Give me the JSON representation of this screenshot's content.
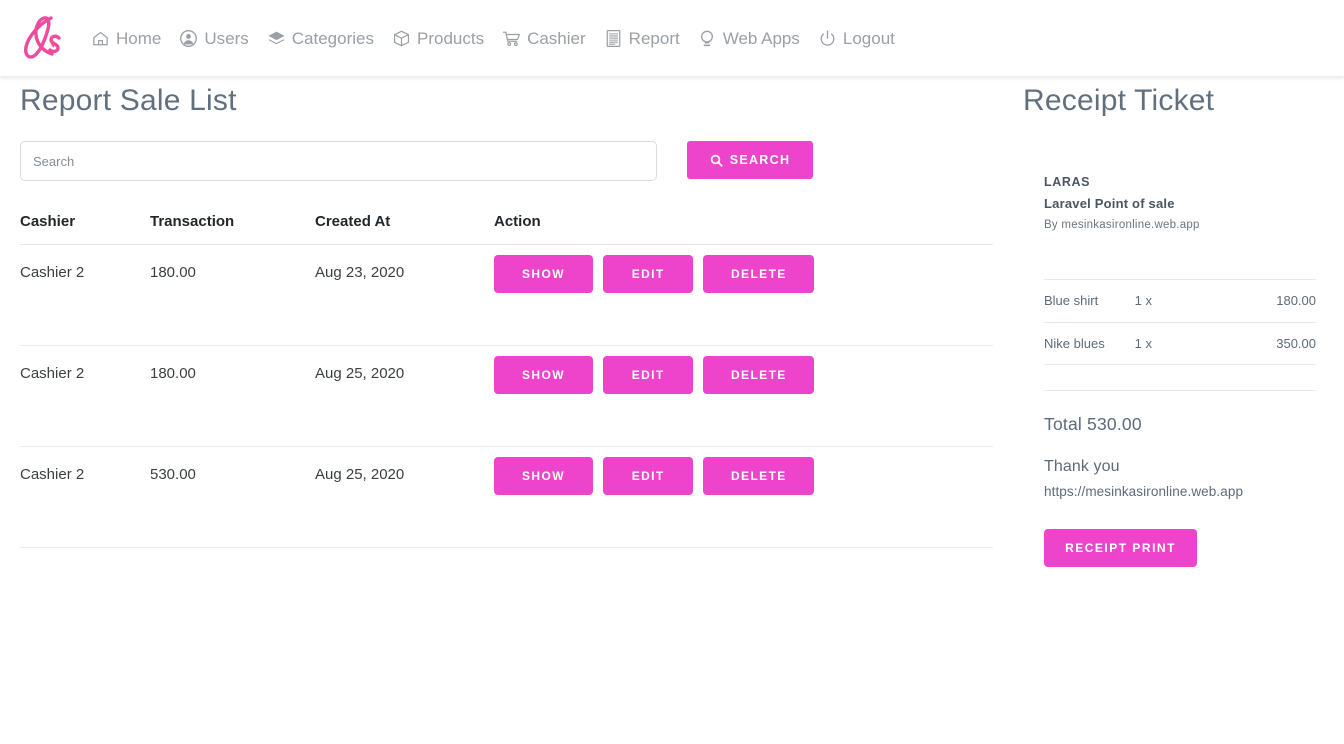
{
  "theme": {
    "accent": "#ee44cc",
    "heading_color": "#62707e",
    "text_color": "#3c4044",
    "muted_color": "#9aa0a6",
    "border_color": "#e8eaec"
  },
  "navbar": {
    "brand_logo": "laras-script-logo",
    "items": [
      {
        "label": "Home",
        "icon": "home-icon"
      },
      {
        "label": "Users",
        "icon": "user-circle-icon"
      },
      {
        "label": "Categories",
        "icon": "layers-icon"
      },
      {
        "label": "Products",
        "icon": "box-icon"
      },
      {
        "label": "Cashier",
        "icon": "shopping-cart-icon"
      },
      {
        "label": "Report",
        "icon": "report-document-icon"
      },
      {
        "label": "Web Apps",
        "icon": "lightbulb-icon"
      },
      {
        "label": "Logout",
        "icon": "power-icon"
      }
    ]
  },
  "main": {
    "title": "Report Sale List",
    "search": {
      "value": "",
      "placeholder": "Search",
      "button_label": "SEARCH",
      "button_icon": "search-icon"
    },
    "table": {
      "columns": [
        "Cashier",
        "Transaction",
        "Created At",
        "Action"
      ],
      "actions": {
        "show": "SHOW",
        "edit": "EDIT",
        "delete": "DELETE"
      },
      "rows": [
        {
          "cashier": "Cashier 2",
          "transaction": "180.00",
          "created_at": "Aug 23, 2020"
        },
        {
          "cashier": "Cashier 2",
          "transaction": "180.00",
          "created_at": "Aug 25, 2020"
        },
        {
          "cashier": "Cashier 2",
          "transaction": "530.00",
          "created_at": "Aug 25, 2020"
        }
      ]
    }
  },
  "receipt": {
    "title": "Receipt Ticket",
    "store_name": "LARAS",
    "store_tagline": "Laravel Point of sale",
    "store_by": "By mesinkasironline.web.app",
    "items": [
      {
        "name": "Blue shirt",
        "qty": "1 x",
        "price": "180.00"
      },
      {
        "name": "Nike blues",
        "qty": "1 x",
        "price": "350.00"
      }
    ],
    "total": "Total 530.00",
    "thanks": "Thank you",
    "url": "https://mesinkasironline.web.app",
    "print_label": "RECEIPT PRINT"
  }
}
